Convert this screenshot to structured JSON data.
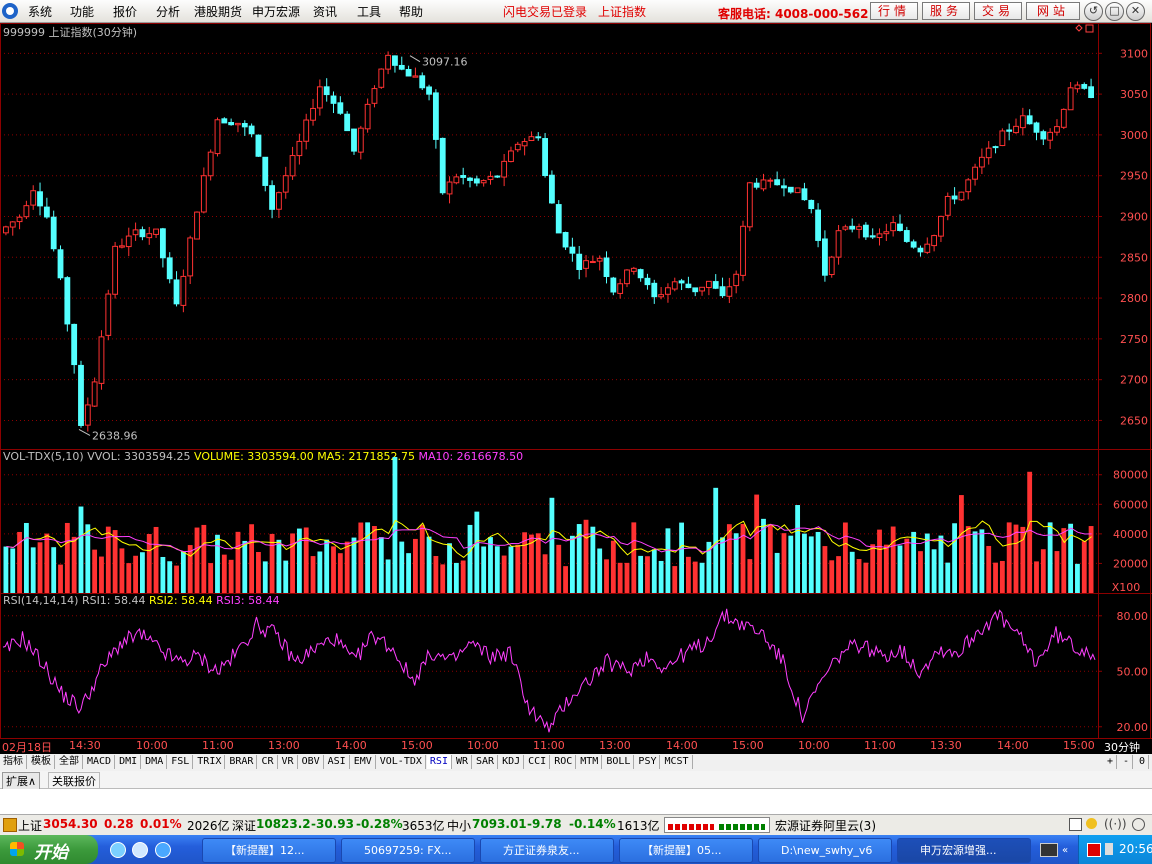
{
  "menubar": {
    "items": [
      "系统",
      "功能",
      "报价",
      "分析",
      "港股期货",
      "申万宏源",
      "资讯",
      "工具",
      "帮助"
    ],
    "status_login": "闪电交易已登录",
    "status_index": "上证指数",
    "hotline": "客服电话: 4008-000-562",
    "service_buttons": [
      "行情",
      "服务",
      "交易",
      "网站"
    ],
    "window_buttons": [
      "↺",
      "□",
      "✕"
    ]
  },
  "chart_data": [
    {
      "type": "candlestick",
      "title": "999999 上证指数(30分钟)",
      "y_ticks": [
        3100,
        3050,
        3000,
        2950,
        2900,
        2850,
        2800,
        2750,
        2700,
        2650
      ],
      "ylim": [
        2615,
        3120
      ],
      "high_label": "3097.16",
      "low_label": "2638.96",
      "path_points": [
        [
          0,
          2880
        ],
        [
          3,
          2900
        ],
        [
          5,
          2935
        ],
        [
          7,
          2900
        ],
        [
          9,
          2820
        ],
        [
          11,
          2720
        ],
        [
          12,
          2640
        ],
        [
          14,
          2700
        ],
        [
          17,
          2860
        ],
        [
          20,
          2880
        ],
        [
          23,
          2880
        ],
        [
          26,
          2790
        ],
        [
          29,
          2910
        ],
        [
          32,
          3020
        ],
        [
          35,
          3015
        ],
        [
          37,
          3000
        ],
        [
          40,
          2910
        ],
        [
          44,
          2990
        ],
        [
          47,
          3060
        ],
        [
          50,
          3030
        ],
        [
          52,
          2980
        ],
        [
          55,
          3060
        ],
        [
          57,
          3100
        ],
        [
          59,
          3080
        ],
        [
          61,
          3070
        ],
        [
          63,
          3050
        ],
        [
          65,
          2930
        ],
        [
          67,
          2950
        ],
        [
          70,
          2940
        ],
        [
          73,
          2950
        ],
        [
          76,
          2990
        ],
        [
          79,
          3000
        ],
        [
          80,
          2950
        ],
        [
          82,
          2880
        ],
        [
          85,
          2840
        ],
        [
          88,
          2850
        ],
        [
          90,
          2810
        ],
        [
          93,
          2840
        ],
        [
          96,
          2800
        ],
        [
          99,
          2820
        ],
        [
          102,
          2810
        ],
        [
          104,
          2820
        ],
        [
          106,
          2800
        ],
        [
          108,
          2830
        ],
        [
          110,
          2940
        ],
        [
          113,
          2940
        ],
        [
          115,
          2940
        ],
        [
          117,
          2930
        ],
        [
          119,
          2910
        ],
        [
          121,
          2830
        ],
        [
          123,
          2880
        ],
        [
          126,
          2890
        ],
        [
          128,
          2870
        ],
        [
          131,
          2890
        ],
        [
          133,
          2870
        ],
        [
          135,
          2860
        ],
        [
          137,
          2880
        ],
        [
          139,
          2920
        ],
        [
          141,
          2930
        ],
        [
          144,
          2970
        ],
        [
          147,
          3000
        ],
        [
          150,
          3020
        ],
        [
          153,
          3000
        ],
        [
          155,
          3010
        ],
        [
          157,
          3060
        ],
        [
          160,
          3050
        ]
      ]
    },
    {
      "type": "bar",
      "title": "VOL-TDX(5,10)",
      "legend": [
        {
          "name": "VVOL",
          "value": "3303594.25",
          "color": "#c0c0c0"
        },
        {
          "name": "VOLUME",
          "value": "3303594.00",
          "color": "#ffff00"
        },
        {
          "name": "MA5",
          "value": "2171852.75",
          "color": "#ffff00"
        },
        {
          "name": "MA10",
          "value": "2616678.50",
          "color": "#ff40ff"
        }
      ],
      "y_ticks": [
        80000,
        60000,
        40000,
        20000
      ],
      "ylim": [
        0,
        92000
      ],
      "unit_label": "X100"
    },
    {
      "type": "line",
      "title": "RSI(14,14,14)",
      "legend": [
        {
          "name": "RSI1",
          "value": "58.44",
          "color": "#c0c0c0"
        },
        {
          "name": "RSI2",
          "value": "58.44",
          "color": "#ffff00"
        },
        {
          "name": "RSI3",
          "value": "58.44",
          "color": "#ff40ff"
        }
      ],
      "y_ticks": [
        80.0,
        50.0,
        20.0
      ],
      "ylim": [
        15,
        88
      ],
      "path_points": [
        [
          0,
          60
        ],
        [
          3,
          68
        ],
        [
          6,
          55
        ],
        [
          9,
          38
        ],
        [
          12,
          30
        ],
        [
          15,
          50
        ],
        [
          18,
          65
        ],
        [
          21,
          70
        ],
        [
          24,
          62
        ],
        [
          27,
          55
        ],
        [
          30,
          58
        ],
        [
          33,
          50
        ],
        [
          36,
          60
        ],
        [
          39,
          75
        ],
        [
          42,
          70
        ],
        [
          45,
          55
        ],
        [
          48,
          62
        ],
        [
          51,
          68
        ],
        [
          54,
          55
        ],
        [
          57,
          70
        ],
        [
          60,
          62
        ],
        [
          63,
          45
        ],
        [
          66,
          60
        ],
        [
          69,
          55
        ],
        [
          72,
          65
        ],
        [
          75,
          58
        ],
        [
          78,
          60
        ],
        [
          81,
          30
        ],
        [
          84,
          18
        ],
        [
          87,
          35
        ],
        [
          90,
          45
        ],
        [
          93,
          55
        ],
        [
          96,
          50
        ],
        [
          99,
          58
        ],
        [
          102,
          52
        ],
        [
          105,
          60
        ],
        [
          108,
          65
        ],
        [
          111,
          80
        ],
        [
          114,
          75
        ],
        [
          117,
          70
        ],
        [
          120,
          55
        ],
        [
          123,
          25
        ],
        [
          126,
          45
        ],
        [
          129,
          60
        ],
        [
          132,
          65
        ],
        [
          135,
          58
        ],
        [
          138,
          62
        ],
        [
          141,
          50
        ],
        [
          144,
          62
        ],
        [
          147,
          60
        ],
        [
          150,
          72
        ],
        [
          153,
          80
        ],
        [
          156,
          70
        ],
        [
          159,
          55
        ],
        [
          162,
          70
        ],
        [
          165,
          63
        ],
        [
          168,
          60
        ]
      ]
    }
  ],
  "time_axis": {
    "date_label": "02月18日",
    "labels": [
      "14:30",
      "10:00",
      "11:00",
      "13:00",
      "14:00",
      "15:00",
      "10:00",
      "11:00",
      "13:00",
      "14:00",
      "15:00",
      "10:00",
      "11:00",
      "13:30",
      "14:00",
      "15:00"
    ],
    "period": "30分钟"
  },
  "indicator_tabs": {
    "left": [
      "指标",
      "模板",
      "全部"
    ],
    "indicators": [
      "MACD",
      "DMI",
      "DMA",
      "FSL",
      "TRIX",
      "BRAR",
      "CR",
      "VR",
      "OBV",
      "ASI",
      "EMV",
      "VOL-TDX",
      "RSI",
      "WR",
      "SAR",
      "KDJ",
      "CCI",
      "ROC",
      "MTM",
      "BOLL",
      "PSY",
      "MCST"
    ],
    "active": "RSI",
    "right": [
      "+",
      "-",
      "0"
    ]
  },
  "ext_tabs": [
    "扩展∧",
    "关联报价"
  ],
  "statusbar": {
    "sh_label": "上证",
    "sh_value": "3054.30",
    "sh_change": "0.28",
    "sh_pct": "0.01%",
    "sh_amount": "2026亿",
    "sz_label": "深证",
    "sz_value": "10823.2",
    "sz_change": "-30.93",
    "sz_pct": "-0.28%",
    "sz_amount": "3653亿",
    "zx_label": "中小",
    "zx_value": "7093.01",
    "zx_change": "-9.78",
    "zx_pct": "-0.14%",
    "zx_amount": "1613亿",
    "server": "宏源证券阿里云(3)"
  },
  "taskbar": {
    "start_label": "开始",
    "tasks": [
      "【新提醒】12...",
      "50697259: FX...",
      "方正证券泉友...",
      "【新提醒】05...",
      "D:\\new_swhy_v6",
      "申万宏源增强..."
    ],
    "clock": "20:56"
  },
  "colors": {
    "up": "#ff3232",
    "down": "#54ffff",
    "grid": "#8c0000",
    "axis_text": "#ff5050"
  }
}
